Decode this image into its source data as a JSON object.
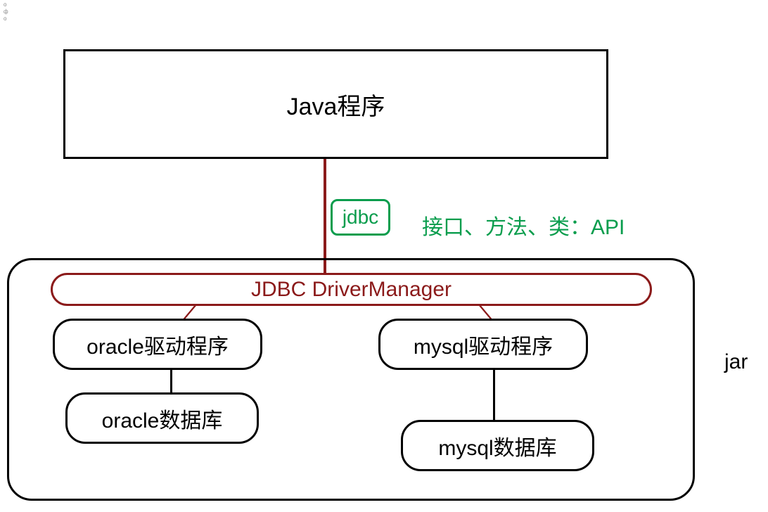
{
  "editor": {
    "mark1": "o",
    "mark2": "ф",
    "mark3": "o"
  },
  "java_box": {
    "label": "Java程序"
  },
  "jdbc": {
    "label": "jdbc",
    "description": "接口、方法、类：API"
  },
  "driver_manager": {
    "label": "JDBC DriverManager"
  },
  "oracle": {
    "driver_label": "oracle驱动程序",
    "db_label": "oracle数据库"
  },
  "mysql": {
    "driver_label": "mysql驱动程序",
    "db_label": "mysql数据库"
  },
  "jar_label": "jar",
  "colors": {
    "accent_red": "#8b1a1a",
    "accent_green": "#0a9d4d",
    "black": "#000000"
  }
}
